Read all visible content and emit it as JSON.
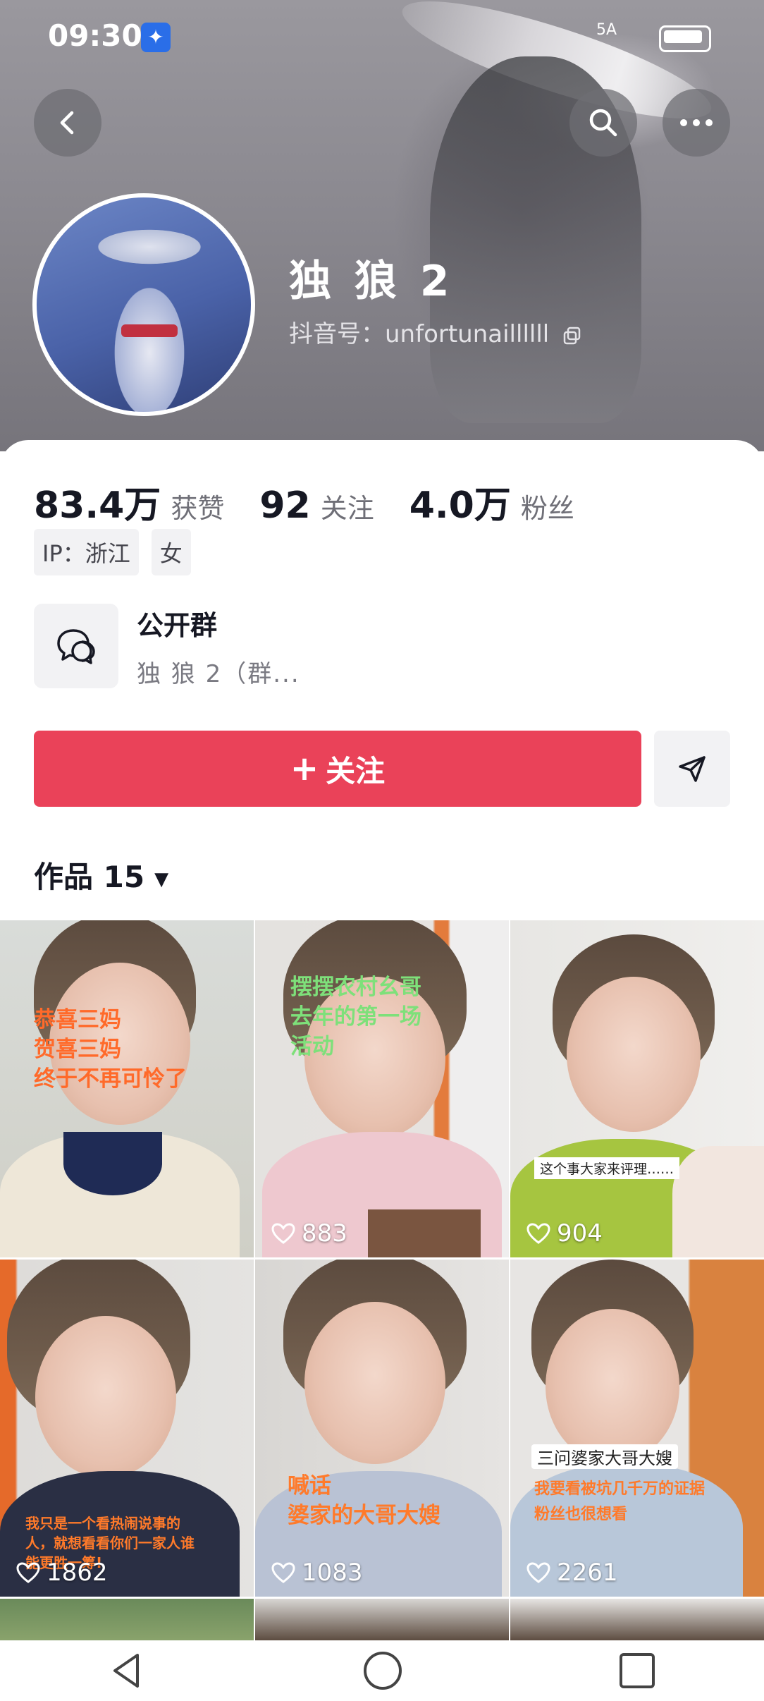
{
  "status_bar": {
    "time": "09:30",
    "network": "5A"
  },
  "profile": {
    "nickname": "独 狼 2",
    "douyin_id": "抖音号：unfortunaillllll"
  },
  "stats": [
    {
      "value": "83.4万",
      "label": "获赞"
    },
    {
      "value": "92",
      "label": "关注"
    },
    {
      "value": "4.0万",
      "label": "粉丝"
    }
  ],
  "tags": [
    "IP：浙江",
    "女"
  ],
  "group": {
    "title": "公开群",
    "subtitle": "独 狼 2（群..."
  },
  "follow_label": "关注",
  "works_label": "作品 15",
  "videos": [
    {
      "caption": "恭喜三妈\n贺喜三妈\n终于不再可怜了",
      "likes": "",
      "caption_color": "#ff6a2a"
    },
    {
      "caption": "摆摆农村幺哥\n去年的第一场\n活动",
      "likes": "883",
      "caption_color": "#7ee07a"
    },
    {
      "caption": "这个事大家来评理……",
      "likes": "904",
      "caption_color": "#222222"
    },
    {
      "caption": "我只是一个看热闹说事的人，就想看看你们一家人谁能更胜一筹!",
      "likes": "1862",
      "caption_color": "#ff7a2a"
    },
    {
      "caption": "喊话\n婆家的大哥大嫂",
      "likes": "1083",
      "caption_color": "#ff7a2a"
    },
    {
      "caption": "三问婆家大哥大嫂",
      "caption2": "我要看被坑几千万的证据\n粉丝也很想看",
      "likes": "2261",
      "caption_color": "#ff7a2a"
    }
  ],
  "icons": {
    "back": "chevron-left-icon",
    "search": "search-icon",
    "more": "more-icon",
    "share": "send-icon",
    "group": "chat-bubbles-icon",
    "like": "heart-icon"
  },
  "colors": {
    "accent": "#ea4259"
  }
}
